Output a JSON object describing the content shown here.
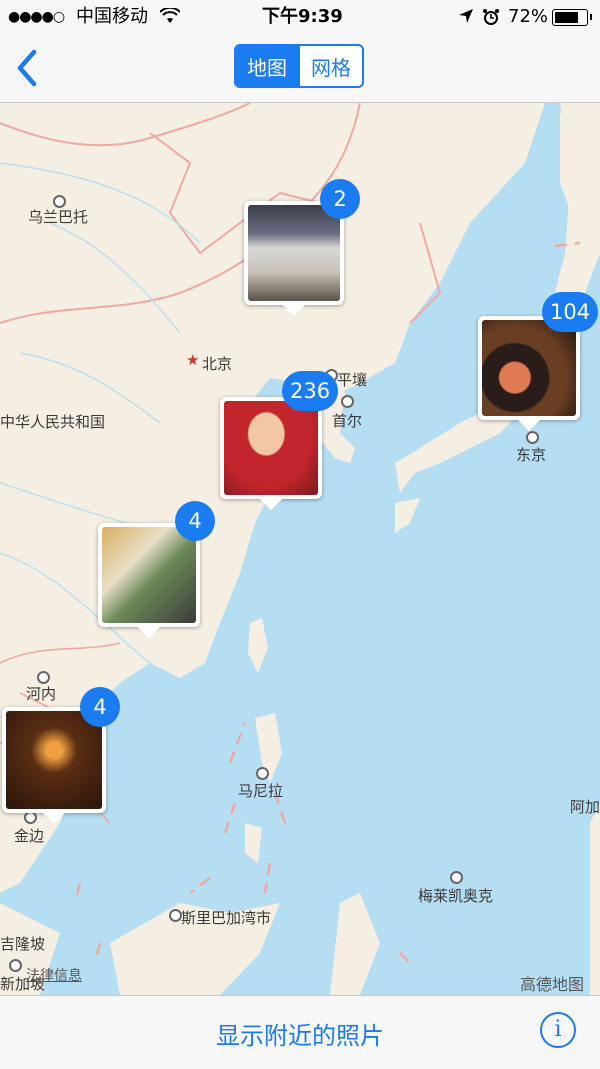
{
  "status": {
    "signal": "●●●●○",
    "carrier": "中国移动",
    "time": "下午9:39",
    "battery": "72%"
  },
  "nav": {
    "seg_map": "地图",
    "seg_grid": "网格"
  },
  "map": {
    "labels": {
      "ulaanbaatar": "乌兰巴托",
      "beijing": "北京",
      "pyongyang": "平壤",
      "seoul": "首尔",
      "china": "中华人民共和国",
      "tokyo": "东京",
      "hanoi": "河内",
      "manila": "马尼拉",
      "phnompenh": "金边",
      "brunei": "斯里巴加湾市",
      "melekeok": "梅莱凯奥克",
      "kualalumpur": "吉隆坡",
      "singapore": "新加坡",
      "agana": "阿加",
      "legal": "法律信息",
      "provider": "高德地图"
    },
    "clusters": {
      "north_count": "2",
      "korea_count": "236",
      "japan_count": "104",
      "shanghai_count": "4",
      "vietnam_count": "4"
    }
  },
  "toolbar": {
    "nearby": "显示附近的照片",
    "info": "i"
  }
}
